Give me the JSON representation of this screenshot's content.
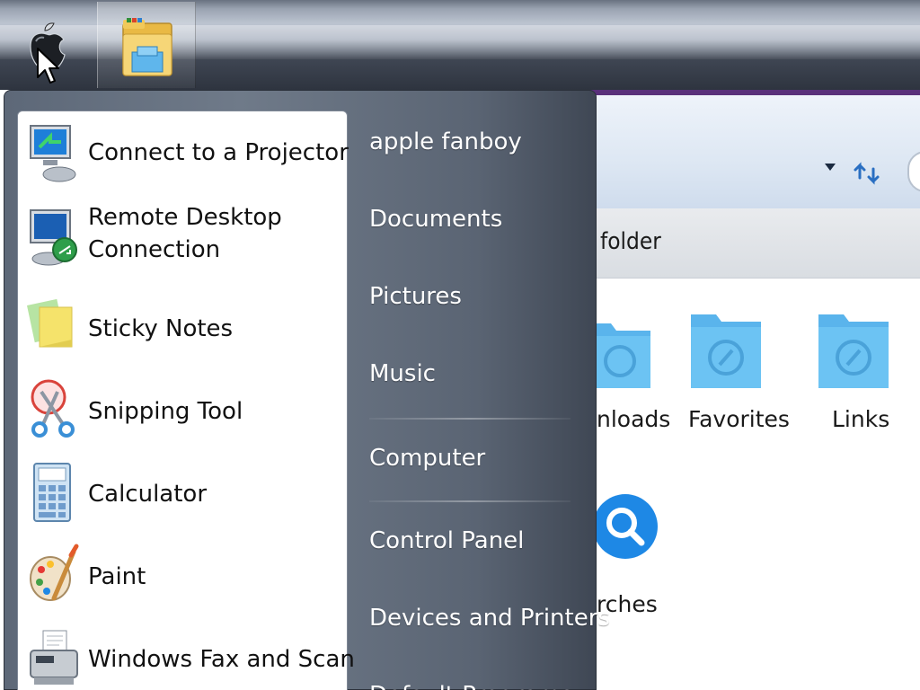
{
  "taskbar": {
    "start_button": {
      "icon": "apple-logo-icon"
    },
    "pinned": [
      {
        "icon": "windows-explorer-icon"
      }
    ]
  },
  "explorer_window": {
    "command_bar_text": "folder",
    "folders": [
      {
        "label": "nloads",
        "icon": "folder-icon"
      },
      {
        "label": "Favorites",
        "icon": "folder-icon"
      },
      {
        "label": "Links",
        "icon": "folder-icon"
      },
      {
        "label": "rches",
        "icon": "searches-icon"
      }
    ]
  },
  "start_menu": {
    "programs": [
      {
        "label": "Connect to a Projector",
        "icon": "projector-icon"
      },
      {
        "label_line1": "Remote Desktop",
        "label_line2": "Connection",
        "icon": "remote-desktop-icon"
      },
      {
        "label": "Sticky Notes",
        "icon": "sticky-notes-icon"
      },
      {
        "label": "Snipping Tool",
        "icon": "snipping-tool-icon"
      },
      {
        "label": "Calculator",
        "icon": "calculator-icon"
      },
      {
        "label": "Paint",
        "icon": "paint-icon"
      },
      {
        "label": "Windows Fax and Scan",
        "icon": "fax-scanner-icon"
      }
    ],
    "places": [
      {
        "label": "apple fanboy"
      },
      {
        "label": "Documents"
      },
      {
        "label": "Pictures"
      },
      {
        "label": "Music"
      },
      {
        "label": "Computer"
      },
      {
        "label": "Control Panel"
      },
      {
        "label": "Devices and Printers"
      },
      {
        "label": "Default Programs"
      }
    ]
  }
}
